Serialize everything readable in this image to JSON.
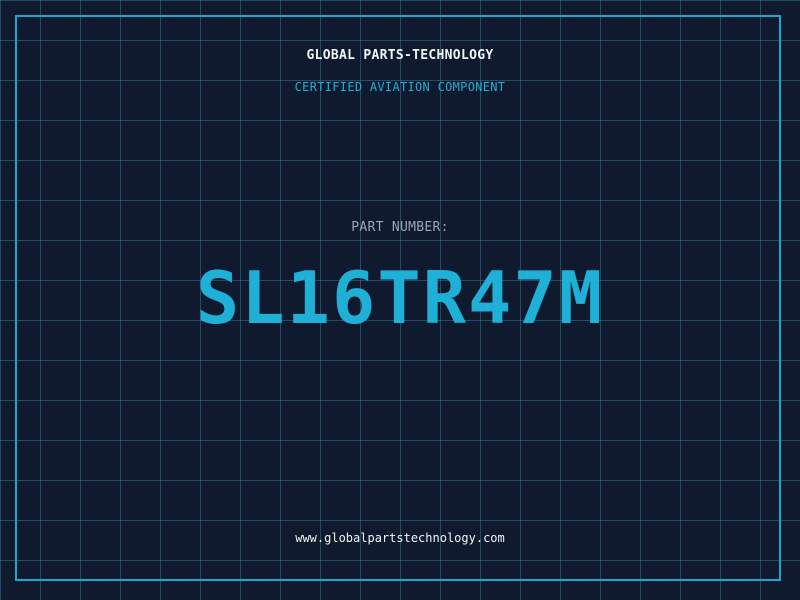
{
  "header": {
    "company": "GLOBAL PARTS-TECHNOLOGY",
    "subtitle": "CERTIFIED AVIATION COMPONENT"
  },
  "part": {
    "label": "PART NUMBER:",
    "number": "SL16TR47M"
  },
  "footer": {
    "url": "www.globalpartstechnology.com"
  },
  "colors": {
    "background": "#101a2e",
    "accent": "#1fb0d8",
    "grid": "#2f6f8a",
    "text": "#f2f5f8",
    "muted": "#9aa6b8"
  }
}
